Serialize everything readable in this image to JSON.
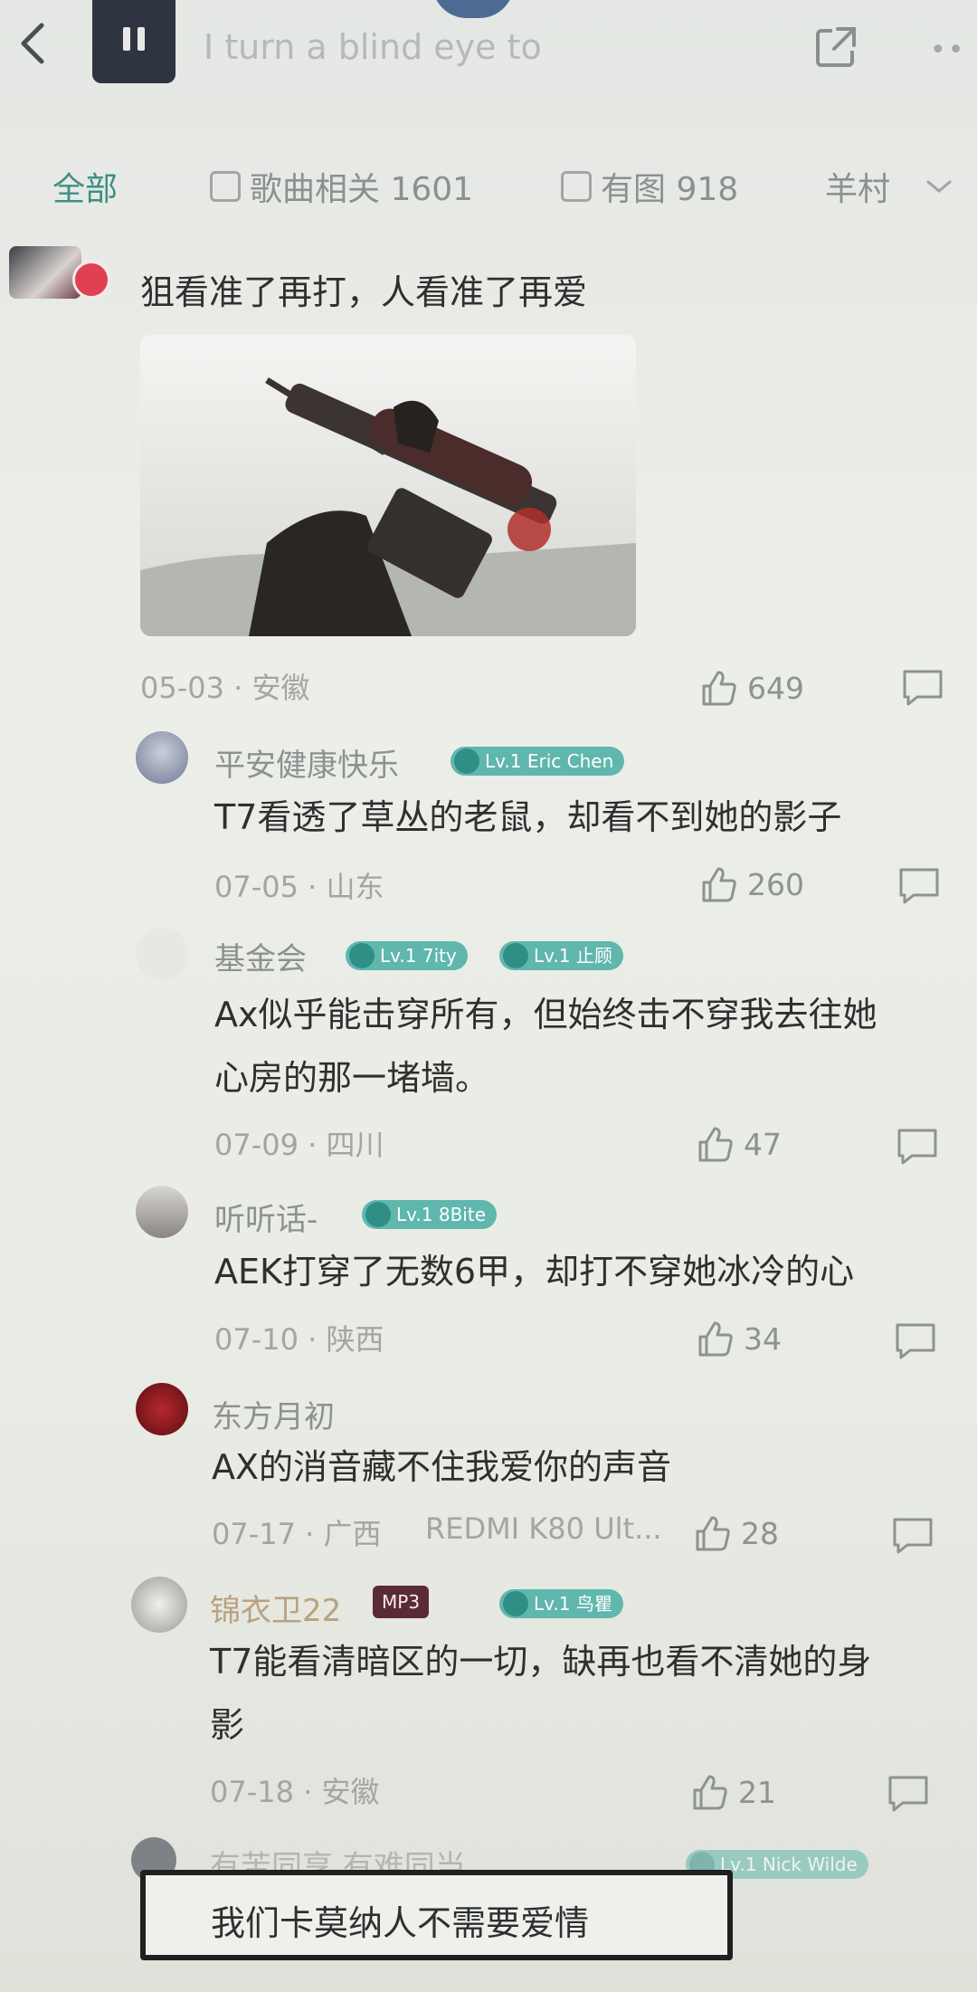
{
  "header": {
    "song_title": "I turn a blind eye to",
    "back_icon": "chevron-left-icon",
    "share_icon": "share-icon",
    "more_icon": "more-icon"
  },
  "tabs": [
    {
      "label": "全部",
      "active": true
    },
    {
      "label": "歌曲相关 1601",
      "icon": "song-icon"
    },
    {
      "label": "有图 918",
      "icon": "image-icon"
    },
    {
      "label": "羊村",
      "icon": "chevron-down-icon"
    }
  ],
  "top_comment": {
    "text": "狙看准了再打，人看准了再爱",
    "date": "05-03 · 安徽",
    "likes": "649"
  },
  "replies": [
    {
      "username": "平安健康快乐",
      "badges": [
        "Lv.1 Eric Chen"
      ],
      "text": "T7看透了草丛的老鼠，却看不到她的影子",
      "date": "07-05 · 山东",
      "likes": "260"
    },
    {
      "username": "基金会",
      "badges": [
        "Lv.1 7ity",
        "Lv.1 止顾"
      ],
      "text_line1": "Ax似乎能击穿所有，但始终击不穿我去往她",
      "text_line2": "心房的那一堵墙。",
      "date": "07-09 · 四川",
      "likes": "47"
    },
    {
      "username": "听听话-",
      "badges": [
        "Lv.1 8Bite"
      ],
      "text": "AEK打穿了无数6甲，却打不穿她冰冷的心",
      "date": "07-10 · 陕西",
      "likes": "34"
    },
    {
      "username": "东方月初",
      "badges": [],
      "text": "AX的消音藏不住我爱你的声音",
      "date": "07-17 · 广西",
      "device": "REDMI K80 Ult...",
      "likes": "28"
    },
    {
      "username": "锦衣卫22",
      "badges": [
        "Lv.1 鸟瞿"
      ],
      "vip_badge": "MP3",
      "text_line1": "T7能看清暗区的一切，缺再也看不清她的身",
      "text_line2": "影",
      "date": "07-18 · 安徽",
      "likes": "21"
    },
    {
      "username": "有苦同享 有难同当",
      "badges": [
        "Lv.1 Nick Wilde"
      ]
    }
  ],
  "reply_bar": {
    "text": "我们卡莫纳人不需要爱情"
  },
  "colors": {
    "accent": "#3f8f84",
    "badge": "#5fb7ad",
    "text": "#2d302f",
    "muted": "#a2a5a3"
  }
}
